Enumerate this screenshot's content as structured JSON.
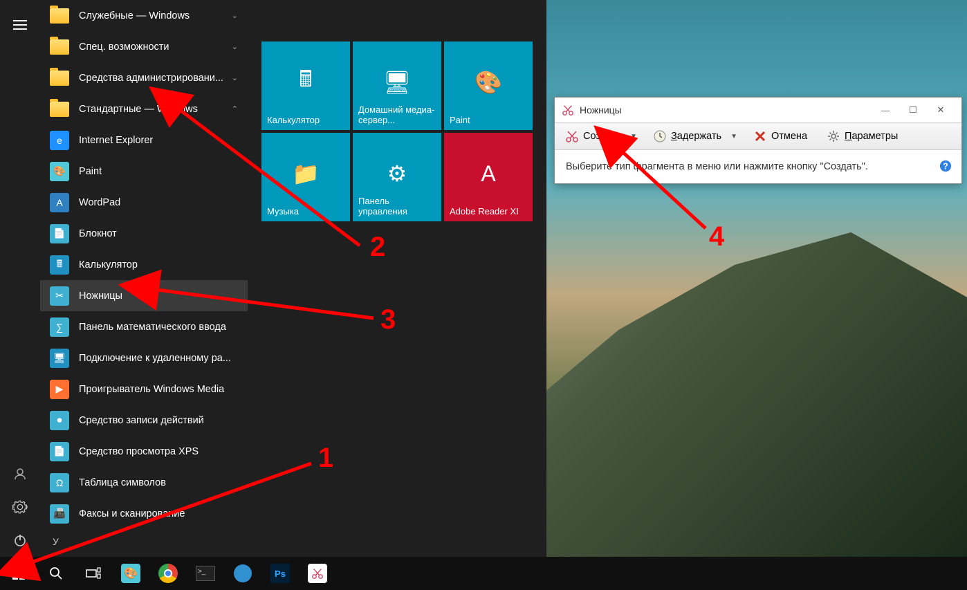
{
  "start_menu": {
    "folders": [
      {
        "label": "Служебные — Windows",
        "expand": "⌄"
      },
      {
        "label": "Спец. возможности",
        "expand": "⌄"
      },
      {
        "label": "Средства администрировани...",
        "expand": "⌄"
      },
      {
        "label": "Стандартные — Windows",
        "expand": "⌃"
      }
    ],
    "apps": [
      {
        "label": "Internet Explorer",
        "icon_bg": "#1e90ff",
        "glyph": "e"
      },
      {
        "label": "Paint",
        "icon_bg": "#50c8d8",
        "glyph": "🎨"
      },
      {
        "label": "WordPad",
        "icon_bg": "#3080c0",
        "glyph": "A"
      },
      {
        "label": "Блокнот",
        "icon_bg": "#40b0d0",
        "glyph": "📄"
      },
      {
        "label": "Калькулятор",
        "icon_bg": "#2090c0",
        "glyph": "🖩"
      },
      {
        "label": "Ножницы",
        "icon_bg": "#40b0d0",
        "glyph": "✂",
        "highlighted": true
      },
      {
        "label": "Панель математического ввода",
        "icon_bg": "#40b0d0",
        "glyph": "∑"
      },
      {
        "label": "Подключение к удаленному ра...",
        "icon_bg": "#2090c0",
        "glyph": "🖥"
      },
      {
        "label": "Проигрыватель Windows Media",
        "icon_bg": "#ff7030",
        "glyph": "▶"
      },
      {
        "label": "Средство записи действий",
        "icon_bg": "#40b0d0",
        "glyph": "⏺"
      },
      {
        "label": "Средство просмотра XPS",
        "icon_bg": "#40b0d0",
        "glyph": "📄"
      },
      {
        "label": "Таблица символов",
        "icon_bg": "#40b0d0",
        "glyph": "Ω"
      },
      {
        "label": "Факсы и сканирование",
        "icon_bg": "#40b0d0",
        "glyph": "📠"
      }
    ],
    "letter_section": "У",
    "tiles": [
      {
        "label": "Калькулятор",
        "glyph": "🖩"
      },
      {
        "label": "Домашний медиа-сервер...",
        "glyph": "🖥"
      },
      {
        "label": "Paint",
        "glyph": "🎨"
      },
      {
        "label": "Музыка",
        "glyph": "📁"
      },
      {
        "label": "Панель управления",
        "glyph": "⚙"
      },
      {
        "label": "Adobe Reader XI",
        "glyph": "A",
        "bg": "#c8102e"
      }
    ]
  },
  "snip_window": {
    "title": "Ножницы",
    "toolbar": {
      "create": "Создать",
      "delay": "Задержать",
      "cancel": "Отмена",
      "params": "Параметры"
    },
    "body_text": "Выберите тип фрагмента в меню или нажмите кнопку \"Создать\"."
  },
  "annotations": {
    "n1": "1",
    "n2": "2",
    "n3": "3",
    "n4": "4"
  }
}
